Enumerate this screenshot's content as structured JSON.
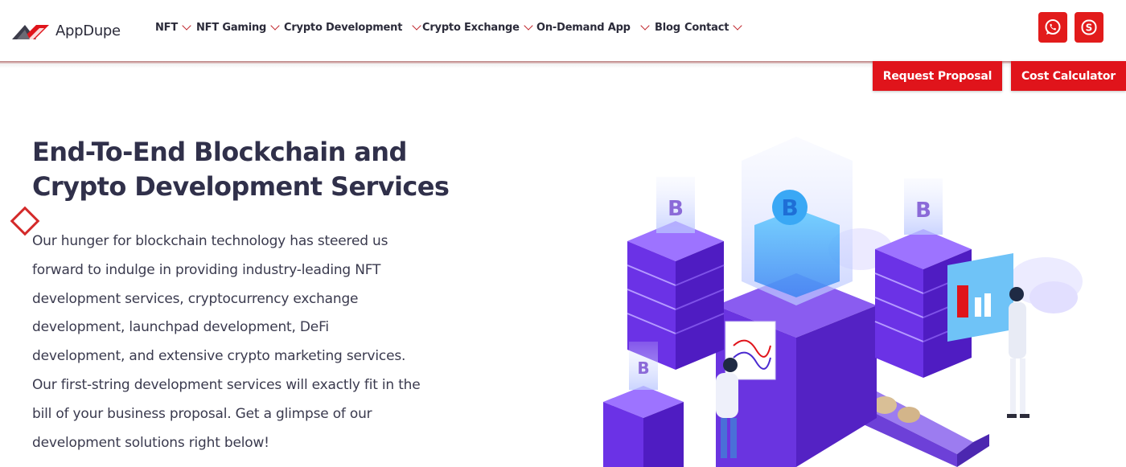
{
  "brand": {
    "name": "AppDupe",
    "accent": "#e0141b",
    "text_color": "#30304a"
  },
  "nav": {
    "items": [
      {
        "label": "NFT",
        "has_dropdown": true
      },
      {
        "label": "NFT Gaming",
        "has_dropdown": true
      },
      {
        "label": "Crypto Development",
        "has_dropdown": true
      },
      {
        "label": "Crypto Exchange",
        "has_dropdown": true
      },
      {
        "label": "On-Demand App",
        "has_dropdown": true
      },
      {
        "label": "Blog",
        "has_dropdown": false
      },
      {
        "label": "Contact",
        "has_dropdown": true
      }
    ]
  },
  "social": {
    "icons": [
      "whatsapp-icon",
      "skype-icon"
    ]
  },
  "cta": {
    "request_proposal": "Request Proposal",
    "cost_calculator": "Cost Calculator"
  },
  "hero": {
    "title_line1": "End-To-End Blockchain and",
    "title_line2": "Crypto Development Services",
    "body_lines": [
      "Our hunger for blockchain technology has steered us",
      "forward to indulge in providing industry-leading NFT",
      "development services, cryptocurrency exchange",
      "development, launchpad development, DeFi",
      "development, and extensive crypto marketing services.",
      "Our first-string development services will exactly fit in the",
      "bill of your business proposal. Get a glimpse of our",
      "development solutions right below!"
    ]
  },
  "illustration": {
    "name": "blockchain-isometric-illustration"
  }
}
